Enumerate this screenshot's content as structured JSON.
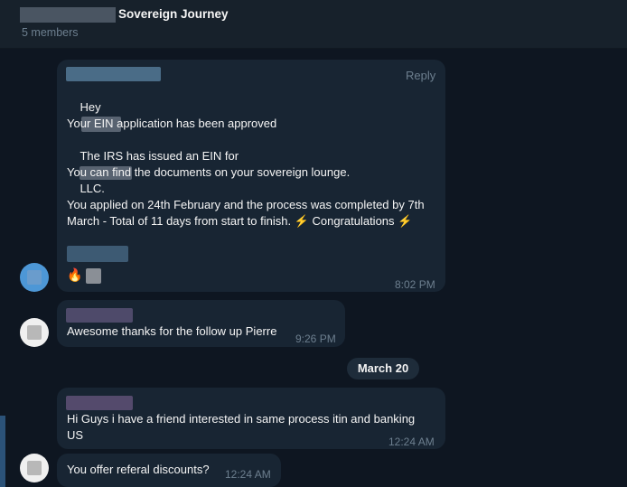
{
  "header": {
    "title": "Sovereign Journey",
    "members": "5 members"
  },
  "messages": {
    "m1": {
      "reply": "Reply",
      "greeting": "Hey",
      "line1": "Your EIN application has been approved",
      "line2a": "The IRS has issued an EIN for",
      "line2b": "LLC.",
      "line3": "You can find the documents on your sovereign lounge.",
      "line4": "You applied on 24th February and the process was completed by 7th",
      "line5": "March - Total of 11 days from start to finish. ⚡ Congratulations ⚡",
      "reaction": "🔥",
      "time": "8:02 PM"
    },
    "m2": {
      "text": "Awesome thanks for the follow up Pierre",
      "time": "9:26 PM"
    },
    "date_divider": "March 20",
    "m3": {
      "line1": "Hi Guys i have a friend interested in same process itin and banking",
      "line2": "US",
      "time": "12:24 AM"
    },
    "m4": {
      "text": "You offer referal discounts?",
      "time": "12:24 AM"
    }
  },
  "colors": {
    "bubble": "#182533",
    "background": "#0e1621",
    "header": "#17212b",
    "muted": "#6d7f8f"
  }
}
